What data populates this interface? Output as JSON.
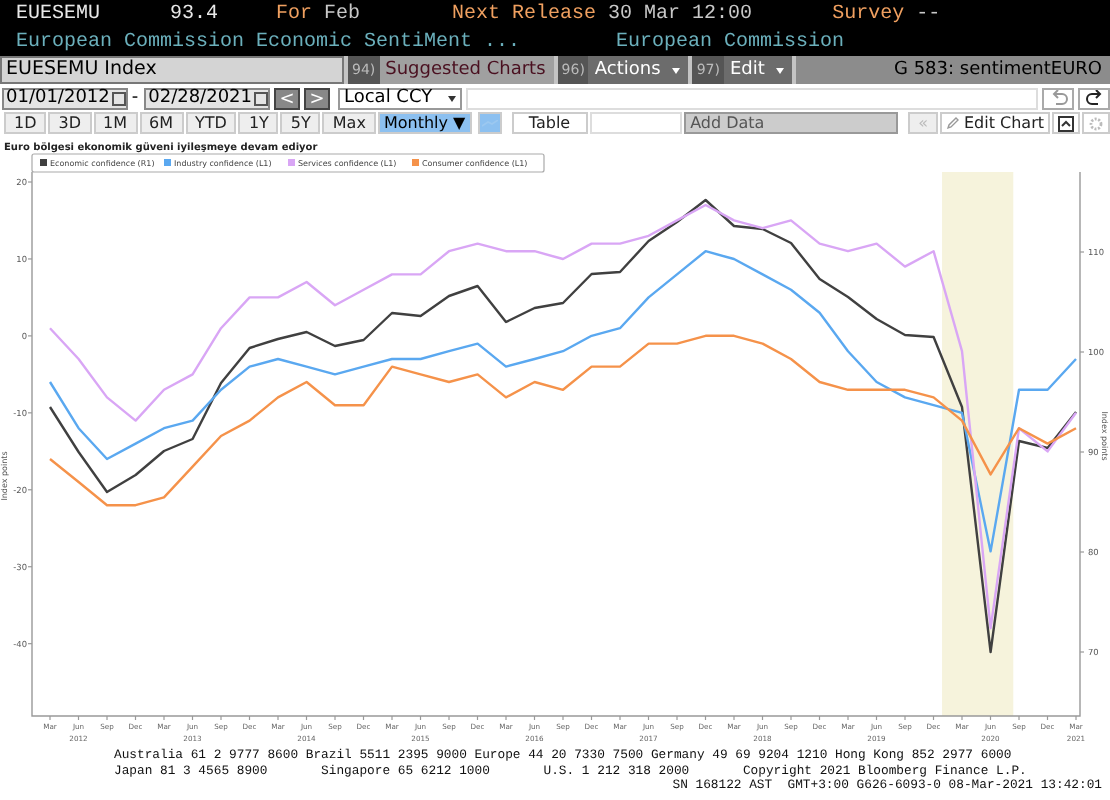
{
  "header": {
    "ticker": "EUESEMU",
    "value": "93.4",
    "period_label": "For",
    "period": "Feb",
    "release_label": "Next Release",
    "release": "30 Mar 12:00",
    "survey_label": "Survey",
    "survey": "--",
    "description": "European Commission Economic SentiMent ...",
    "source": "European Commission"
  },
  "toolbar": {
    "security": "EUESEMU Index",
    "buttons": [
      {
        "number": "94)",
        "label": "Suggested Charts",
        "kind": "plain"
      },
      {
        "number": "96)",
        "label": "Actions",
        "kind": "menu"
      },
      {
        "number": "97)",
        "label": "Edit",
        "kind": "menu"
      }
    ],
    "chart_id": "G 583: sentimentEURO"
  },
  "dates": {
    "start": "01/01/2012",
    "separator": "-",
    "end": "02/28/2021",
    "prev": "<",
    "next": ">",
    "currency": "Local CCY"
  },
  "periods": [
    {
      "label": "1D",
      "selected": false
    },
    {
      "label": "3D",
      "selected": false
    },
    {
      "label": "1M",
      "selected": false
    },
    {
      "label": "6M",
      "selected": false
    },
    {
      "label": "YTD",
      "selected": false
    },
    {
      "label": "1Y",
      "selected": false
    },
    {
      "label": "5Y",
      "selected": false
    },
    {
      "label": "Max",
      "selected": false
    }
  ],
  "frequency": {
    "label": "Monthly",
    "arrow": "▼",
    "selected": true
  },
  "table_button": "Table",
  "add_data": {
    "placeholder": "Add Data"
  },
  "collapse": "«",
  "edit_chart": "Edit Chart",
  "chart": {
    "title": "Euro bölgesi ekonomik güveni iyileşmeye devam ediyor",
    "year_labels": [
      "2012",
      "2013",
      "2014",
      "2015",
      "2016",
      "2017",
      "2018",
      "2019",
      "2020",
      "2021"
    ],
    "chart_data": {
      "type": "line",
      "ylabel": "Index points",
      "y2label": "Index points",
      "categories": [
        "Mar",
        "Jun",
        "Sep",
        "Dec",
        "Mar",
        "Jun",
        "Sep",
        "Dec",
        "Mar",
        "Jun",
        "Sep",
        "Dec",
        "Mar",
        "Jun",
        "Sep",
        "Dec",
        "Mar",
        "Jun",
        "Sep",
        "Dec",
        "Mar",
        "Jun",
        "Sep",
        "Dec",
        "Mar",
        "Jun",
        "Sep",
        "Dec",
        "Mar",
        "Jun",
        "Sep",
        "Dec",
        "Mar",
        "Jun",
        "Sep",
        "Dec",
        "Mar"
      ],
      "series": [
        {
          "name": "Economic confidence (R1)",
          "color": "#404040",
          "axis": "y2",
          "values": [
            94.5,
            90.0,
            86.0,
            87.7,
            90.1,
            91.3,
            96.9,
            100.4,
            101.3,
            102.0,
            100.6,
            101.2,
            103.9,
            103.6,
            105.6,
            106.6,
            103.0,
            104.4,
            104.9,
            107.8,
            108.0,
            111.1,
            113.0,
            115.2,
            112.6,
            112.3,
            110.9,
            107.3,
            105.5,
            103.3,
            101.7,
            101.5,
            94.5,
            70.0,
            91.1,
            90.4,
            94.0
          ]
        },
        {
          "name": "Industry confidence (L1)",
          "color": "#5aa8f0",
          "values": [
            -6,
            -12,
            -16,
            -14,
            -12,
            -11,
            -7,
            -4,
            -3,
            -4,
            -5,
            -4,
            -3,
            -3,
            -2,
            -1,
            -4,
            -3,
            -2,
            0,
            1,
            5,
            8,
            11,
            10,
            8,
            6,
            3,
            -2,
            -6,
            -8,
            -9,
            -10,
            -28,
            -7,
            -7,
            -3
          ]
        },
        {
          "name": "Services confidence (L1)",
          "color": "#d9a6f5",
          "values": [
            1,
            -3,
            -8,
            -11,
            -7,
            -5,
            1,
            5,
            5,
            7,
            4,
            6,
            8,
            8,
            11,
            12,
            11,
            11,
            10,
            12,
            12,
            13,
            15,
            17,
            15,
            14,
            15,
            12,
            11,
            12,
            9,
            11,
            -2,
            -38,
            -12,
            -15,
            -10
          ]
        },
        {
          "name": "Consumer confidence (L1)",
          "color": "#f5924a",
          "values": [
            -16,
            -19,
            -22,
            -22,
            -21,
            -17,
            -13,
            -11,
            -8,
            -6,
            -9,
            -9,
            -4,
            -5,
            -6,
            -5,
            -8,
            -6,
            -7,
            -4,
            -4,
            -1,
            -1,
            0,
            0,
            -1,
            -3,
            -6,
            -7,
            -7,
            -7,
            -8,
            -11,
            -18,
            -12,
            -14,
            -12
          ]
        }
      ],
      "ylim": [
        -49.4,
        21.3
      ],
      "yticks": [
        -40,
        -30,
        -20,
        -10,
        0,
        10,
        20
      ],
      "y2lim": [
        63.6,
        118
      ],
      "y2ticks": [
        70,
        80,
        90,
        100,
        110
      ],
      "legend": "top left"
    }
  },
  "footer": {
    "lines": [
      "Australia 61 2 9777 8600 Brazil 5511 2395 9000 Europe 44 20 7330 7500 Germany 49 69 9204 1210 Hong Kong 852 2977 6000",
      "Japan 81 3 4565 8900       Singapore 65 6212 1000       U.S. 1 212 318 2000       Copyright 2021 Bloomberg Finance L.P."
    ],
    "session": "SN 168122 AST  GMT+3:00 G626-6093-0 08-Mar-2021 13:42:01"
  }
}
